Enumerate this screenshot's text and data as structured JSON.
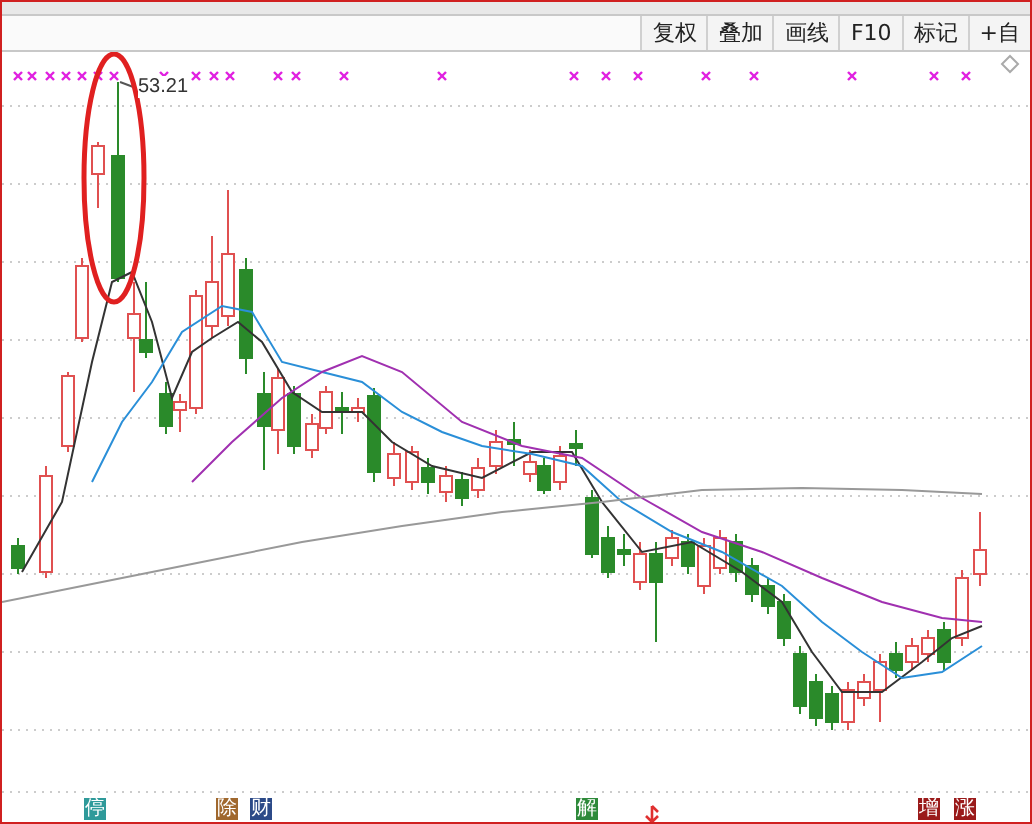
{
  "toolbar": {
    "buttons": [
      "复权",
      "叠加",
      "画线",
      "F10",
      "标记",
      "+自"
    ]
  },
  "chart": {
    "price_label": "53.21",
    "event_badges": [
      {
        "label": "停",
        "color": "#2f9a9a"
      },
      {
        "label": "除",
        "color": "#a0682e"
      },
      {
        "label": "财",
        "color": "#2c4a88"
      },
      {
        "label": "解",
        "color": "#2e8a3a"
      },
      {
        "label": "增",
        "color": "#9a1a1a"
      },
      {
        "label": "涨",
        "color": "#9a1a1a"
      }
    ]
  }
}
